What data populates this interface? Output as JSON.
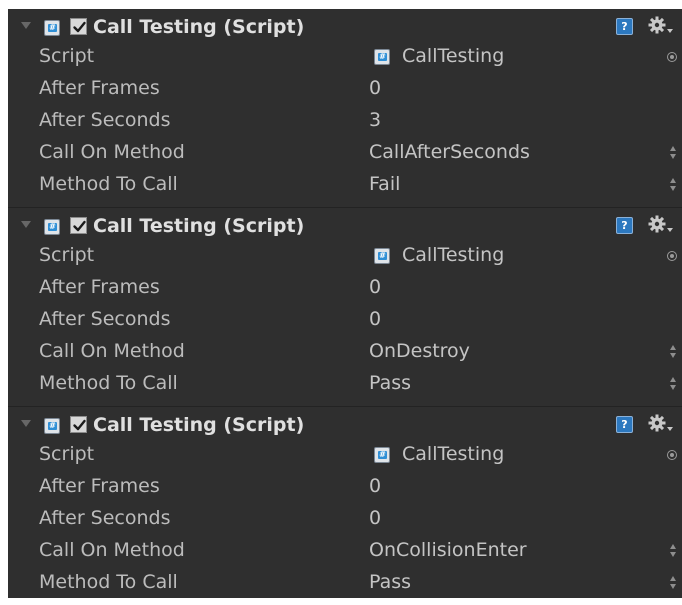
{
  "components": [
    {
      "title": "Call Testing (Script)",
      "enabled": true,
      "icons": {
        "script": "csharp-script-icon",
        "help": "help-icon",
        "settings": "gear-icon"
      },
      "script_label": "Script",
      "script_value": "CallTesting",
      "after_frames_label": "After Frames",
      "after_frames_value": "0",
      "after_seconds_label": "After Seconds",
      "after_seconds_value": "3",
      "call_on_method_label": "Call On Method",
      "call_on_method_value": "CallAfterSeconds",
      "method_to_call_label": "Method To Call",
      "method_to_call_value": "Fail"
    },
    {
      "title": "Call Testing (Script)",
      "enabled": true,
      "icons": {
        "script": "csharp-script-icon",
        "help": "help-icon",
        "settings": "gear-icon"
      },
      "script_label": "Script",
      "script_value": "CallTesting",
      "after_frames_label": "After Frames",
      "after_frames_value": "0",
      "after_seconds_label": "After Seconds",
      "after_seconds_value": "0",
      "call_on_method_label": "Call On Method",
      "call_on_method_value": "OnDestroy",
      "method_to_call_label": "Method To Call",
      "method_to_call_value": "Pass"
    },
    {
      "title": "Call Testing (Script)",
      "enabled": true,
      "icons": {
        "script": "csharp-script-icon",
        "help": "help-icon",
        "settings": "gear-icon"
      },
      "script_label": "Script",
      "script_value": "CallTesting",
      "after_frames_label": "After Frames",
      "after_frames_value": "0",
      "after_seconds_label": "After Seconds",
      "after_seconds_value": "0",
      "call_on_method_label": "Call On Method",
      "call_on_method_value": "OnCollisionEnter",
      "method_to_call_label": "Method To Call",
      "method_to_call_value": "Pass"
    }
  ],
  "colors": {
    "panel_background": "#2f2f2f",
    "title_text": "#e0e0e0",
    "label_text": "#bcbcbc",
    "script_icon_accent": "#2f8fd6",
    "help_icon": "#2c78bf"
  }
}
